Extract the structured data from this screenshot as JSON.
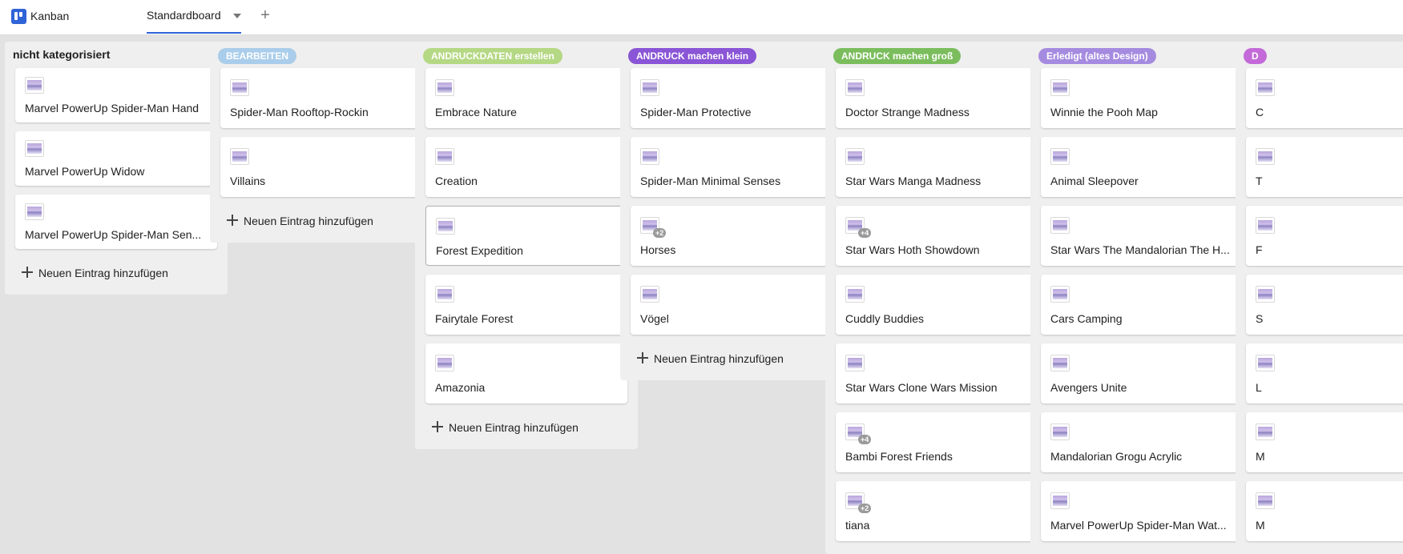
{
  "app": {
    "name": "Kanban"
  },
  "board_tab": {
    "label": "Standardboard"
  },
  "add_entry_label": "Neuen Eintrag hinzufügen",
  "columns": [
    {
      "title": "nicht kategorisiert",
      "color": "",
      "cards": [
        {
          "title": "Marvel PowerUp Spider-Man Hand",
          "badge": ""
        },
        {
          "title": "Marvel PowerUp Widow",
          "badge": ""
        },
        {
          "title": "Marvel PowerUp Spider-Man Sen...",
          "badge": ""
        }
      ]
    },
    {
      "title": "BEARBEITEN",
      "color": "#a9cdea",
      "cards": [
        {
          "title": "Spider-Man Rooftop-Rockin",
          "badge": ""
        },
        {
          "title": "Villains",
          "badge": ""
        }
      ]
    },
    {
      "title": "ANDRUCKDATEN erstellen",
      "color": "#b5d884",
      "cards": [
        {
          "title": "Embrace Nature",
          "badge": ""
        },
        {
          "title": "Creation",
          "badge": ""
        },
        {
          "title": "Forest Expedition",
          "badge": ""
        },
        {
          "title": "Fairytale Forest",
          "badge": ""
        },
        {
          "title": "Amazonia",
          "badge": ""
        }
      ]
    },
    {
      "title": "ANDRUCK machen klein",
      "color": "#8a55d6",
      "cards": [
        {
          "title": "Spider-Man Protective",
          "badge": ""
        },
        {
          "title": "Spider-Man Minimal Senses",
          "badge": ""
        },
        {
          "title": "Horses",
          "badge": "+2"
        },
        {
          "title": "Vögel",
          "badge": ""
        }
      ]
    },
    {
      "title": "ANDRUCK machen groß",
      "color": "#7bbd5d",
      "cards": [
        {
          "title": "Doctor Strange Madness",
          "badge": ""
        },
        {
          "title": "Star Wars Manga Madness",
          "badge": ""
        },
        {
          "title": "Star Wars Hoth Showdown",
          "badge": "+4"
        },
        {
          "title": "Cuddly Buddies",
          "badge": ""
        },
        {
          "title": "Star Wars Clone Wars Mission",
          "badge": ""
        },
        {
          "title": "Bambi Forest Friends",
          "badge": "+4"
        },
        {
          "title": "tiana",
          "badge": "+2"
        }
      ]
    },
    {
      "title": "Erledigt (altes Design)",
      "color": "#a58be0",
      "cards": [
        {
          "title": "Winnie the Pooh Map",
          "badge": ""
        },
        {
          "title": "Animal Sleepover",
          "badge": ""
        },
        {
          "title": "Star Wars The Mandalorian The H...",
          "badge": ""
        },
        {
          "title": "Cars Camping",
          "badge": ""
        },
        {
          "title": "Avengers Unite",
          "badge": ""
        },
        {
          "title": "Mandalorian Grogu Acrylic",
          "badge": ""
        },
        {
          "title": "Marvel PowerUp Spider-Man Wat...",
          "badge": ""
        }
      ]
    },
    {
      "title": "D",
      "color": "#c36ad8",
      "cards": [
        {
          "title": "C",
          "badge": ""
        },
        {
          "title": "T",
          "badge": ""
        },
        {
          "title": "F",
          "badge": ""
        },
        {
          "title": "S",
          "badge": ""
        },
        {
          "title": "L",
          "badge": ""
        },
        {
          "title": "M",
          "badge": ""
        },
        {
          "title": "M",
          "badge": ""
        }
      ]
    }
  ]
}
